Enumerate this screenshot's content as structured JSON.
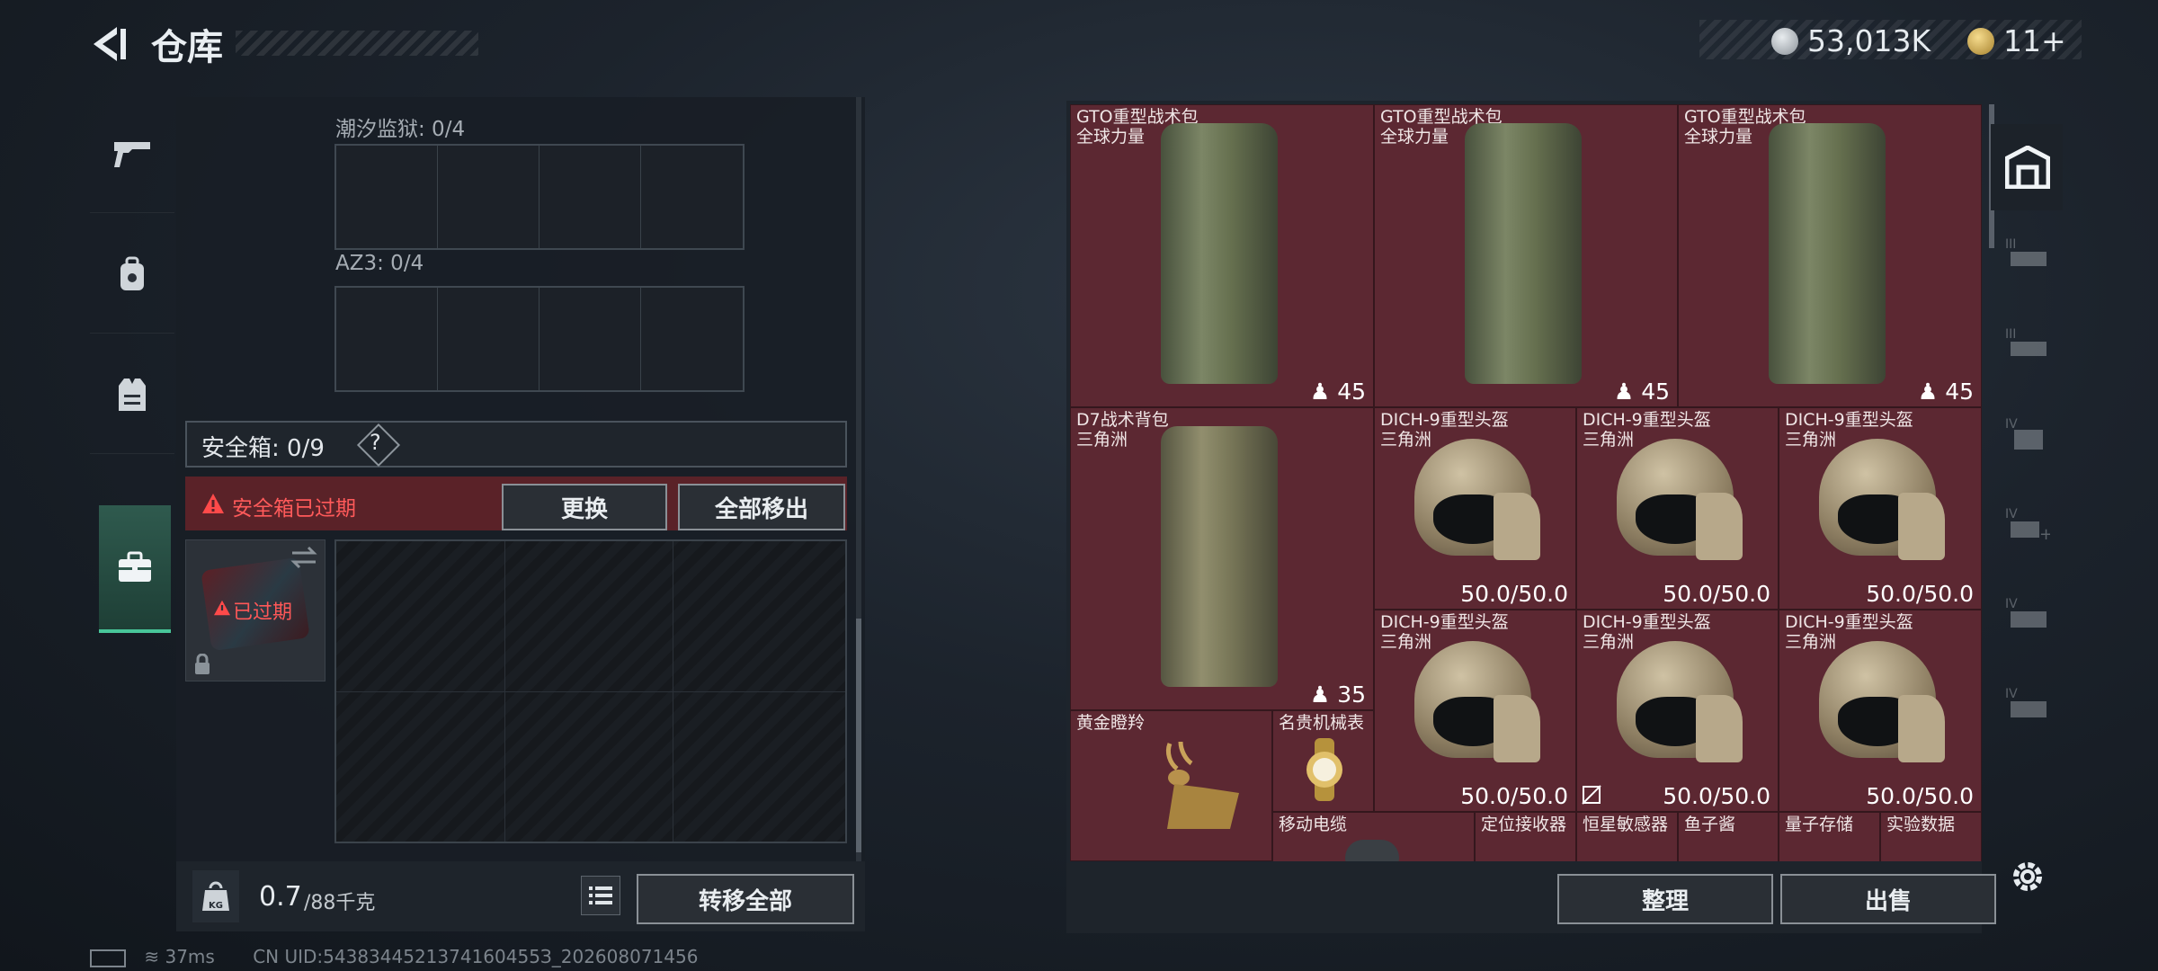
{
  "header": {
    "title": "仓库",
    "currency_1": "53,013K",
    "currency_2": "11+",
    "colors": {
      "coin1": "#b8bcc1",
      "coin2": "#d9b45a"
    }
  },
  "left_tabs": [
    {
      "icon": "gun-icon"
    },
    {
      "icon": "backpack-icon"
    },
    {
      "icon": "vest-icon"
    },
    {
      "icon": "toolbox-icon",
      "active": true
    }
  ],
  "containers": {
    "tide_prison": "潮汐监狱: 0/4",
    "az3": "AZ3: 0/4"
  },
  "safe_box": {
    "label": "安全箱: 0/9",
    "help": "?",
    "expired_text": "安全箱已过期",
    "replace_button": "更换",
    "move_all_button": "全部移出",
    "case_badge": "已过期"
  },
  "left_footer": {
    "weight_current": "0.7",
    "weight_max": "/88千克",
    "weight_icon_label": "KG",
    "transfer_all_button": "转移全部"
  },
  "stash_items": [
    {
      "name": "GTO重型战术包",
      "sub": "全球力量",
      "qty": "45"
    },
    {
      "name": "GTO重型战术包",
      "sub": "全球力量",
      "qty": "45"
    },
    {
      "name": "GTO重型战术包",
      "sub": "全球力量",
      "qty": "45"
    },
    {
      "name": "D7战术背包",
      "sub": "三角洲",
      "qty": "35"
    },
    {
      "name": "DICH-9重型头盔",
      "sub": "三角洲",
      "durability": "50.0/50.0"
    },
    {
      "name": "DICH-9重型头盔",
      "sub": "三角洲",
      "durability": "50.0/50.0"
    },
    {
      "name": "DICH-9重型头盔",
      "sub": "三角洲",
      "durability": "50.0/50.0"
    },
    {
      "name": "DICH-9重型头盔",
      "sub": "三角洲",
      "durability": "50.0/50.0"
    },
    {
      "name": "DICH-9重型头盔",
      "sub": "三角洲",
      "durability": "50.0/50.0"
    },
    {
      "name": "DICH-9重型头盔",
      "sub": "三角洲",
      "durability": "50.0/50.0"
    },
    {
      "name": "黄金瞪羚"
    },
    {
      "name": "名贵机械表"
    },
    {
      "name": "移动电缆"
    },
    {
      "name": "定位接收器"
    },
    {
      "name": "恒星敏感器"
    },
    {
      "name": "鱼子酱"
    },
    {
      "name": "量子存储"
    },
    {
      "name": "实验数据"
    }
  ],
  "right_footer": {
    "organize_button": "整理",
    "sell_button": "出售"
  },
  "right_rail": {
    "levels": [
      "III",
      "III",
      "IV",
      "IV",
      "IV",
      "IV"
    ]
  },
  "status_bar": {
    "ping": "37ms",
    "uid": "CN UID:5438344521374160455З_202608071456"
  }
}
